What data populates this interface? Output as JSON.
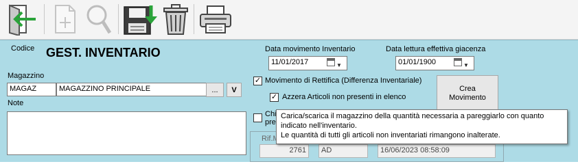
{
  "toolbar": {
    "icons": [
      "exit-icon",
      "new-document-icon",
      "search-icon",
      "save-icon",
      "delete-icon",
      "print-icon"
    ]
  },
  "form": {
    "codice_label": "Codice",
    "title": "GEST. INVENTARIO",
    "magazzino_label": "Magazzino",
    "magazzino_code": "MAGAZ",
    "magazzino_name": "MAGAZZINO PRINCIPALE",
    "browse_label": "...",
    "v_label": "V",
    "note_label": "Note",
    "note_value": "",
    "data_movimento_label": "Data movimento Inventario",
    "data_movimento_value": "11/01/2017",
    "data_lettura_label": "Data lettura effettiva giacenza",
    "data_lettura_value": "01/01/1900",
    "rettifica_label": "Movimento di Rettifica (Differenza Inventariale)",
    "rettifica_checked": true,
    "azzera_label": "Azzera Articoli non presenti in elenco",
    "azzera_checked": true,
    "chi_label_1": "Chi",
    "chi_label_2": "pre",
    "chi_checked": false,
    "crea_movimento_label": [
      "Crea",
      "Movimento"
    ],
    "rif_label": "Rif.M",
    "rif_number": "2761",
    "rif_code": "AD",
    "rif_datetime": "16/06/2023 08:58:09"
  },
  "tooltip": {
    "lines": [
      "Carica/scarica il magazzino della quantità necessaria a pareggiarlo con quanto",
      "indicato nell'inventario.",
      "Le quantità di tutti gli articoli non inventariati rimangono inalterate."
    ]
  }
}
